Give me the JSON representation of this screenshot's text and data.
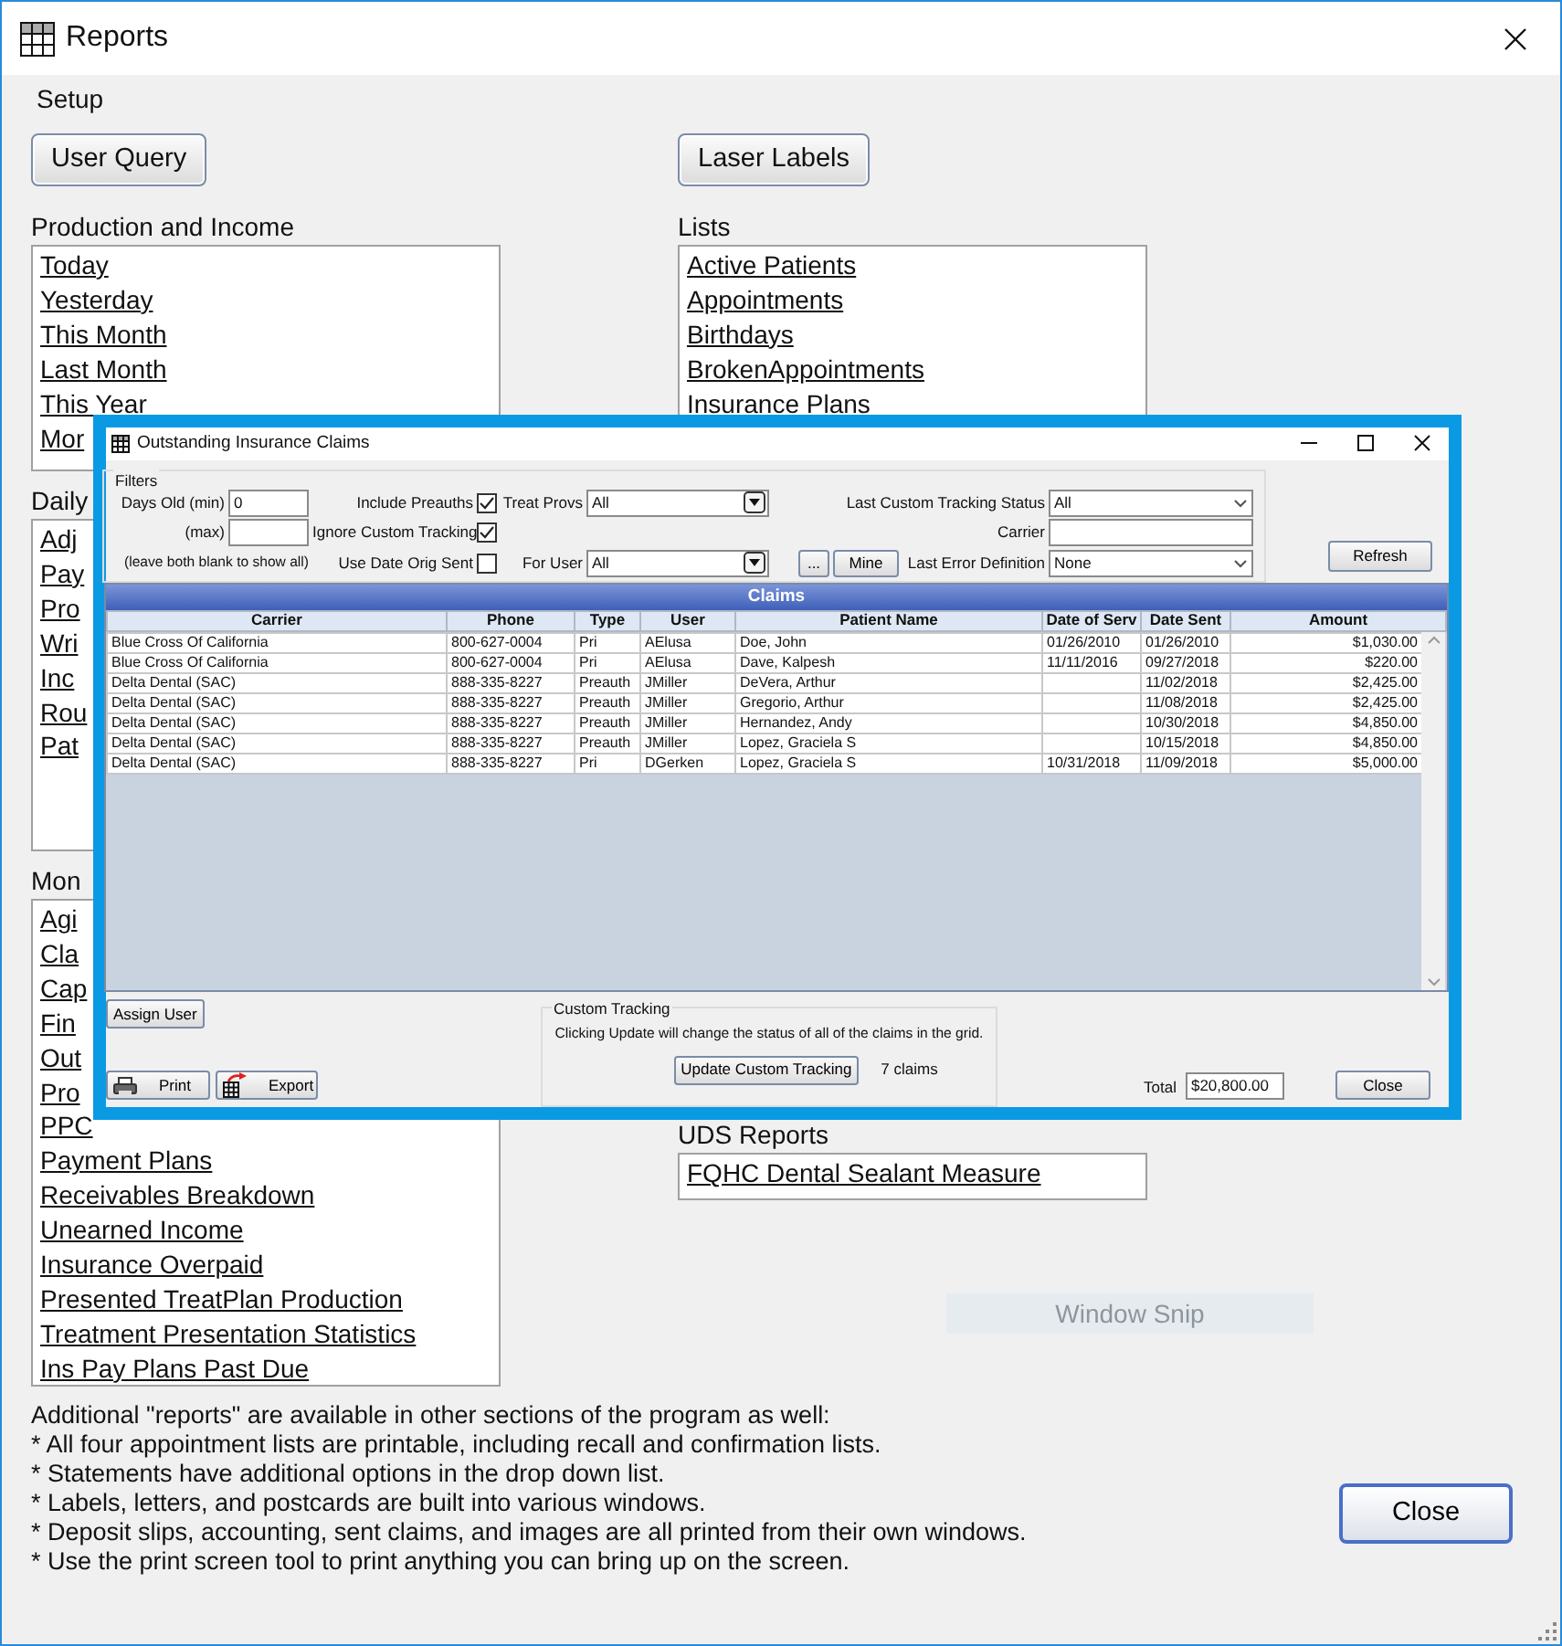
{
  "window": {
    "title": "Reports"
  },
  "setup_label": "Setup",
  "left_column": [
    {
      "kind": "button",
      "label": "User Query"
    },
    {
      "kind": "group",
      "heading": "Production and Income",
      "items": [
        "Today",
        "Yesterday",
        "This Month",
        "Last Month",
        "This Year",
        "Mor"
      ]
    },
    {
      "kind": "group",
      "heading": "Daily",
      "items": [
        "Adj",
        "Pay",
        "Pro",
        "Wri",
        "Inc",
        "Rou",
        "Pat"
      ]
    },
    {
      "kind": "group",
      "heading": "Mon",
      "items": [
        "Agi",
        "Cla",
        "Cap",
        "Fin",
        "Out",
        "Pro",
        "PPC",
        "Payment Plans",
        "Receivables Breakdown",
        "Unearned Income",
        "Insurance Overpaid",
        "Presented TreatPlan Production",
        "Treatment Presentation Statistics",
        "Ins Pay Plans Past Due"
      ]
    }
  ],
  "right_column": [
    {
      "kind": "button",
      "label": "Laser Labels"
    },
    {
      "kind": "group",
      "heading": "Lists",
      "items": [
        "Active Patients",
        "Appointments",
        "Birthdays",
        "BrokenAppointments",
        "Insurance Plans"
      ]
    },
    {
      "kind": "group",
      "heading": "UDS Reports",
      "items": [
        "FQHC Dental Sealant Measure"
      ]
    }
  ],
  "tooltip": "Window Snip",
  "notes": [
    "Additional \"reports\" are available in other sections of the program as well:",
    "* All four appointment lists are printable, including recall and confirmation lists.",
    "* Statements have additional options in the drop down list.",
    "* Labels, letters, and postcards are built into various windows.",
    "* Deposit slips, accounting, sent claims, and images are all printed from their own windows.",
    "* Use the print screen tool to print anything you can bring up on the screen."
  ],
  "close_button": "Close",
  "claims_dialog": {
    "title": "Outstanding Insurance Claims",
    "filters": {
      "label": "Filters",
      "days_min": {
        "label": "Days Old (min)",
        "value": "0"
      },
      "days_max": {
        "label": "(max)"
      },
      "hint": "(leave both blank to show all)",
      "checks": [
        {
          "label": "Include Preauths",
          "checked": true
        },
        {
          "label": "Ignore Custom Tracking",
          "checked": true
        },
        {
          "label": "Use Date Orig Sent",
          "checked": false
        }
      ],
      "treat_provs": {
        "label": "Treat Provs",
        "value": "All"
      },
      "for_user": {
        "label": "For User",
        "value": "All"
      },
      "more_button": "...",
      "mine_button": "Mine",
      "tracking_status": {
        "label": "Last Custom Tracking Status",
        "value": "All"
      },
      "carrier": {
        "label": "Carrier"
      },
      "error_definition": {
        "label": "Last Error Definition",
        "value": "None"
      }
    },
    "refresh_button": "Refresh",
    "grid": {
      "title": "Claims",
      "columns": [
        "Carrier",
        "Phone",
        "Type",
        "User",
        "Patient Name",
        "Date of Serv",
        "Date Sent",
        "Amount"
      ],
      "rows": [
        {
          "carrier": "Blue Cross Of California",
          "phone": "800-627-0004",
          "type": "Pri",
          "user": "AElusa",
          "patient": "Doe, John",
          "date_of_serv": "01/26/2010",
          "date_sent": "01/26/2010",
          "amount": "$1,030.00"
        },
        {
          "carrier": "Blue Cross Of California",
          "phone": "800-627-0004",
          "type": "Pri",
          "user": "AElusa",
          "patient": "Dave, Kalpesh",
          "date_of_serv": "11/11/2016",
          "date_sent": "09/27/2018",
          "amount": "$220.00"
        },
        {
          "carrier": "Delta Dental (SAC)",
          "phone": "888-335-8227",
          "type": "Preauth",
          "user": "JMiller",
          "patient": "DeVera, Arthur",
          "date_sent": "11/02/2018",
          "amount": "$2,425.00"
        },
        {
          "carrier": "Delta Dental (SAC)",
          "phone": "888-335-8227",
          "type": "Preauth",
          "user": "JMiller",
          "patient": "Gregorio, Arthur",
          "date_sent": "11/08/2018",
          "amount": "$2,425.00"
        },
        {
          "carrier": "Delta Dental (SAC)",
          "phone": "888-335-8227",
          "type": "Preauth",
          "user": "JMiller",
          "patient": "Hernandez, Andy",
          "date_sent": "10/30/2018",
          "amount": "$4,850.00"
        },
        {
          "carrier": "Delta Dental (SAC)",
          "phone": "888-335-8227",
          "type": "Preauth",
          "user": "JMiller",
          "patient": "Lopez, Graciela S",
          "date_sent": "10/15/2018",
          "amount": "$4,850.00"
        },
        {
          "carrier": "Delta Dental (SAC)",
          "phone": "888-335-8227",
          "type": "Pri",
          "user": "DGerken",
          "patient": "Lopez, Graciela S",
          "date_of_serv": "10/31/2018",
          "date_sent": "11/09/2018",
          "amount": "$5,000.00"
        }
      ]
    },
    "assign_button": "Assign User",
    "custom_tracking": {
      "label": "Custom Tracking",
      "note": "Clicking Update will change the status of all of the claims in the grid.",
      "button": "Update Custom Tracking",
      "count": "7 claims"
    },
    "print_button": "Print",
    "export_button": "Export",
    "total": {
      "label": "Total",
      "value": "$20,800.00"
    },
    "dialog_close_button": "Close"
  }
}
